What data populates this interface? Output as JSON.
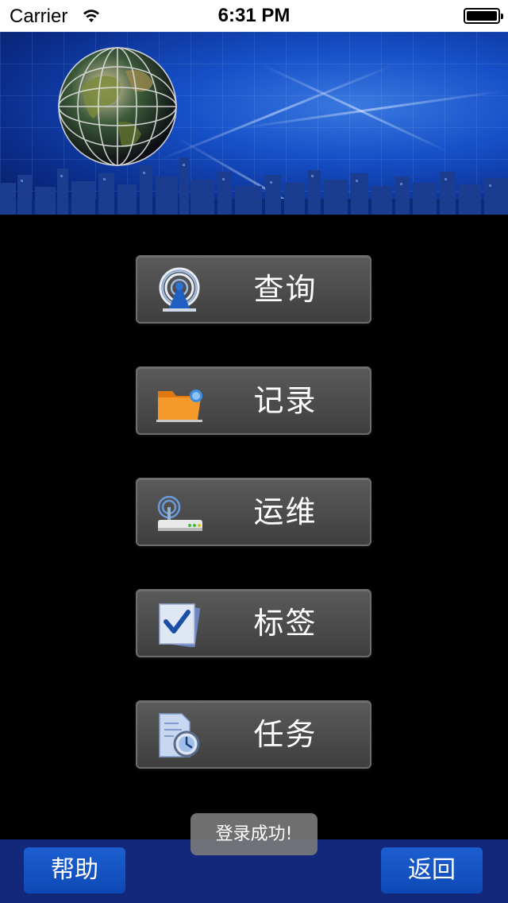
{
  "status_bar": {
    "carrier": "Carrier",
    "time": "6:31 PM"
  },
  "menu": {
    "items": [
      {
        "label": "查询",
        "icon": "radar-icon"
      },
      {
        "label": "记录",
        "icon": "folder-icon"
      },
      {
        "label": "运维",
        "icon": "router-icon"
      },
      {
        "label": "标签",
        "icon": "checklist-icon"
      },
      {
        "label": "任务",
        "icon": "clock-document-icon"
      }
    ]
  },
  "toast": {
    "message": "登录成功!"
  },
  "bottom_bar": {
    "help_label": "帮助",
    "back_label": "返回"
  },
  "colors": {
    "banner_blue": "#1650c8",
    "bottom_bar": "#13287a",
    "button_blue": "#1c5fd0",
    "menu_button_gray": "#4a4a4a"
  }
}
